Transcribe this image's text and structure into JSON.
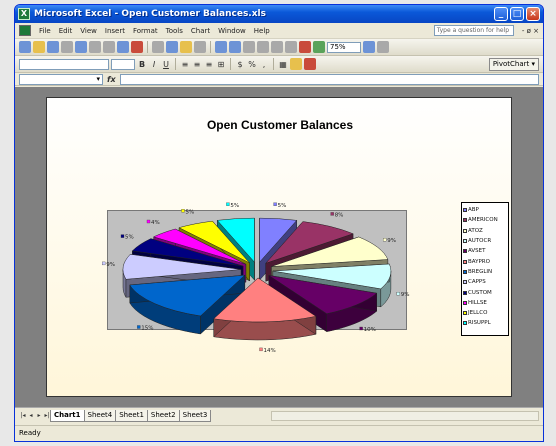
{
  "window": {
    "title": "Microsoft Excel - Open Customer Balances.xls",
    "buttons": [
      "_",
      "□",
      "×"
    ]
  },
  "menu": {
    "items": [
      "File",
      "Edit",
      "View",
      "Insert",
      "Format",
      "Tools",
      "Chart",
      "Window",
      "Help"
    ],
    "help_placeholder": "Type a question for help",
    "right_glyph": "- ø ×"
  },
  "toolbar": {
    "zoom": "75%",
    "pivot_button": "PivotChart ▾"
  },
  "formula_bar": {
    "name_box": "▾",
    "fx": "fx"
  },
  "chart_data": {
    "type": "pie",
    "title": "Open Customer Balances",
    "exploded": true,
    "three_d": true,
    "legend_position": "right",
    "categories": [
      "ABP",
      "AMERICON",
      "ATOZ",
      "AUTOCR",
      "AVSET",
      "BAYPRO",
      "BREGLIN",
      "CAPPS",
      "CUSTOM",
      "HILLSE",
      "JELLCO",
      "RISUPPL"
    ],
    "slice_labels": [
      "5%",
      "8%",
      "9%",
      "9%",
      "10%",
      "14%",
      "15%",
      "9%",
      "5%",
      "4%",
      "5%",
      "5%"
    ],
    "values": [
      5,
      8,
      9,
      9,
      10,
      14,
      15,
      9,
      5,
      4,
      5,
      5
    ],
    "colors": [
      "#8080ff",
      "#993366",
      "#ffffcc",
      "#ccffff",
      "#660066",
      "#ff8080",
      "#0066cc",
      "#ccccff",
      "#000080",
      "#ff00ff",
      "#ffff00",
      "#00ffff"
    ]
  },
  "sheets": {
    "nav": [
      "|◂",
      "◂",
      "▸",
      "▸|"
    ],
    "tabs": [
      "Chart1",
      "Sheet4",
      "Sheet1",
      "Sheet2",
      "Sheet3"
    ],
    "active": "Chart1"
  },
  "status": {
    "text": "Ready"
  }
}
